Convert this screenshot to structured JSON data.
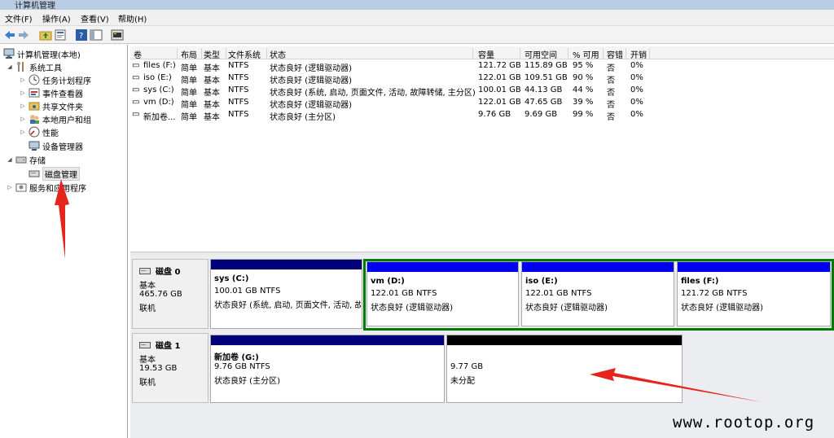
{
  "window": {
    "title": "计算机管理"
  },
  "menu": [
    "文件(F)",
    "操作(A)",
    "查看(V)",
    "帮助(H)"
  ],
  "toolbar": [
    "back-icon",
    "forward-icon",
    "up-folder-icon",
    "properties-icon",
    "help-icon",
    "show-hide-icon",
    "console-icon"
  ],
  "tree": {
    "root": "计算机管理(本地)",
    "system_tools": "系统工具",
    "task_scheduler": "任务计划程序",
    "event_viewer": "事件查看器",
    "shared_folders": "共享文件夹",
    "local_users": "本地用户和组",
    "performance": "性能",
    "device_manager": "设备管理器",
    "storage": "存储",
    "disk_management": "磁盘管理",
    "services": "服务和应用程序"
  },
  "volume_list": {
    "headers": [
      "卷",
      "布局",
      "类型",
      "文件系统",
      "状态",
      "容量",
      "可用空间",
      "% 可用",
      "容错",
      "开销"
    ],
    "rows": [
      [
        "files (F:)",
        "简单",
        "基本",
        "NTFS",
        "状态良好 (逻辑驱动器)",
        "121.72 GB",
        "115.89 GB",
        "95 %",
        "否",
        "0%"
      ],
      [
        "iso (E:)",
        "简单",
        "基本",
        "NTFS",
        "状态良好 (逻辑驱动器)",
        "122.01 GB",
        "109.51 GB",
        "90 %",
        "否",
        "0%"
      ],
      [
        "sys (C:)",
        "简单",
        "基本",
        "NTFS",
        "状态良好 (系统, 启动, 页面文件, 活动, 故障转储, 主分区)",
        "100.01 GB",
        "44.13 GB",
        "44 %",
        "否",
        "0%"
      ],
      [
        "vm (D:)",
        "简单",
        "基本",
        "NTFS",
        "状态良好 (逻辑驱动器)",
        "122.01 GB",
        "47.65 GB",
        "39 %",
        "否",
        "0%"
      ],
      [
        "新加卷...",
        "简单",
        "基本",
        "NTFS",
        "状态良好 (主分区)",
        "9.76 GB",
        "9.69 GB",
        "99 %",
        "否",
        "0%"
      ]
    ]
  },
  "disk0": {
    "name": "磁盘 0",
    "type": "基本",
    "size": "465.76 GB",
    "status": "联机",
    "partitions": [
      {
        "name": "sys  (C:)",
        "size": "100.01 GB NTFS",
        "status": "状态良好 (系统, 启动, 页面文件, 活动, 故"
      },
      {
        "name": "vm  (D:)",
        "size": "122.01 GB NTFS",
        "status": "状态良好 (逻辑驱动器)"
      },
      {
        "name": "iso  (E:)",
        "size": "122.01 GB NTFS",
        "status": "状态良好 (逻辑驱动器)"
      },
      {
        "name": "files  (F:)",
        "size": "121.72 GB NTFS",
        "status": "状态良好 (逻辑驱动器)"
      }
    ]
  },
  "disk1": {
    "name": "磁盘 1",
    "type": "基本",
    "size": "19.53 GB",
    "status": "联机",
    "partitions": [
      {
        "name": "新加卷  (G:)",
        "size": "9.76 GB NTFS",
        "status": "状态良好 (主分区)"
      },
      {
        "name": "",
        "size": "9.77 GB",
        "status": "未分配"
      }
    ]
  },
  "colors": {
    "primary_bar": "#00007a",
    "logical_bar": "#0000f0",
    "unallocated_bar": "#000000",
    "extended_border": "#007a00",
    "arrow": "#e5241e"
  },
  "watermark": "www.rootop.org"
}
